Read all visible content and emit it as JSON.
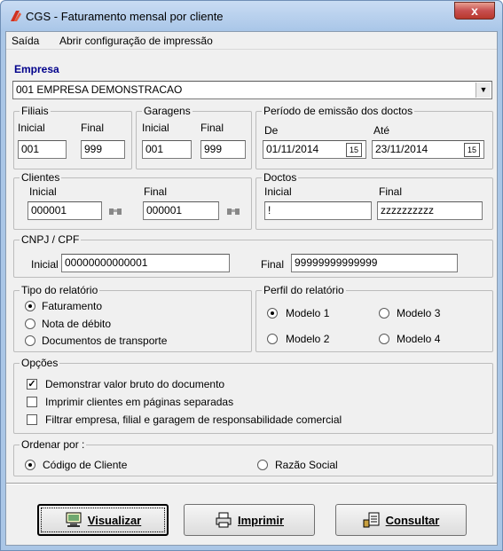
{
  "window": {
    "title": "CGS - Faturamento mensal por cliente",
    "close_glyph": "x"
  },
  "menu": {
    "saida": "Saída",
    "config": "Abrir configuração de impressão"
  },
  "empresa": {
    "label": "Empresa",
    "value": "001 EMPRESA DEMONSTRACAO"
  },
  "filiais": {
    "title": "Filiais",
    "inicial_label": "Inicial",
    "final_label": "Final",
    "inicial": "001",
    "final": "999"
  },
  "garagens": {
    "title": "Garagens",
    "inicial_label": "Inicial",
    "final_label": "Final",
    "inicial": "001",
    "final": "999"
  },
  "periodo": {
    "title": "Período de emissão dos doctos",
    "de_label": "De",
    "ate_label": "Até",
    "de": "01/11/2014",
    "ate": "23/11/2014",
    "cal_glyph": "15"
  },
  "clientes": {
    "title": "Clientes",
    "inicial_label": "Inicial",
    "final_label": "Final",
    "inicial": "000001",
    "final": "000001"
  },
  "doctos": {
    "title": "Doctos",
    "inicial_label": "Inicial",
    "final_label": "Final",
    "inicial": "!",
    "final": "zzzzzzzzzz"
  },
  "cnpj": {
    "title": "CNPJ / CPF",
    "inicial_label": "Inicial",
    "final_label": "Final",
    "inicial": "00000000000001",
    "final": "99999999999999"
  },
  "tipo": {
    "title": "Tipo do relatório",
    "options": [
      "Faturamento",
      "Nota de débito",
      "Documentos de transporte"
    ],
    "selected": 0
  },
  "perfil": {
    "title": "Perfil do relatório",
    "options": [
      "Modelo 1",
      "Modelo 3",
      "Modelo 2",
      "Modelo 4"
    ],
    "selected": "Modelo 1"
  },
  "opcoes": {
    "title": "Opções",
    "items": [
      {
        "label": "Demonstrar valor bruto do documento",
        "checked": true
      },
      {
        "label": "Imprimir clientes em páginas separadas",
        "checked": false
      },
      {
        "label": "Filtrar empresa, filial e garagem de responsabilidade comercial",
        "checked": false
      }
    ]
  },
  "ordenar": {
    "title": "Ordenar por :",
    "options": [
      "Código de Cliente",
      "Razão Social"
    ],
    "selected": "Código de Cliente"
  },
  "buttons": {
    "visualizar": "Visualizar",
    "imprimir": "Imprimir",
    "consultar": "Consultar"
  },
  "colors": {
    "title_bar": "#b5cdee",
    "accent_label": "#00008b",
    "close": "#c75050"
  }
}
